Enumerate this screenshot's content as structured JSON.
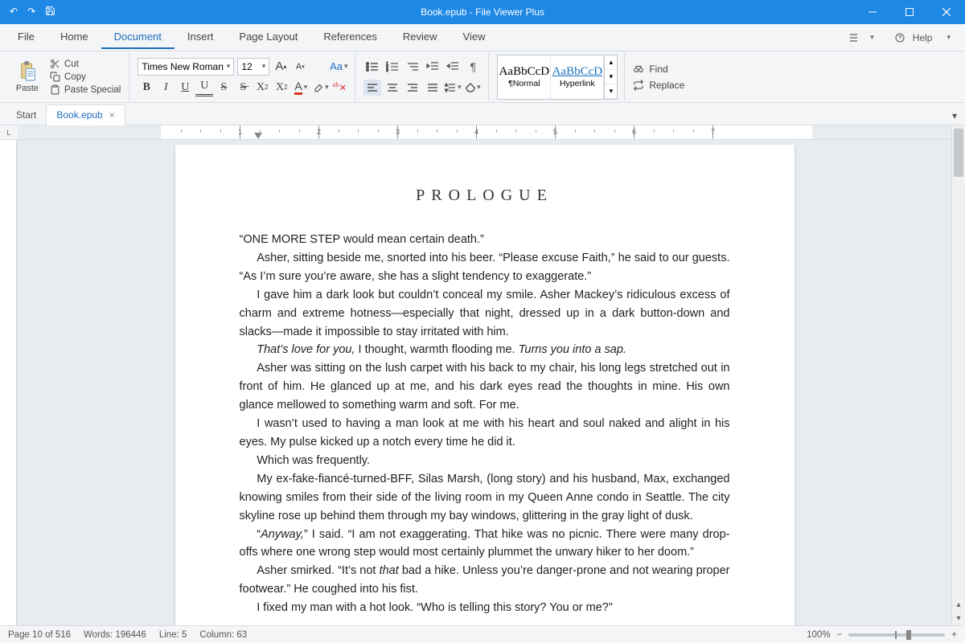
{
  "title": "Book.epub - File Viewer Plus",
  "menu": {
    "items": [
      "File",
      "Home",
      "Document",
      "Insert",
      "Page Layout",
      "References",
      "Review",
      "View"
    ],
    "activeIndex": 2,
    "help": "Help"
  },
  "clipboard": {
    "paste": "Paste",
    "cut": "Cut",
    "copy": "Copy",
    "pasteSpecial": "Paste Special"
  },
  "font": {
    "name": "Times New Roman",
    "size": "12",
    "aa": "Aa"
  },
  "styles": {
    "preview": "AaBbCcD",
    "normal": "¶Normal",
    "hyperlink": "Hyperlink"
  },
  "editing": {
    "find": "Find",
    "replace": "Replace"
  },
  "tabs": {
    "start": "Start",
    "doc": "Book.epub"
  },
  "ruler": {
    "corner": "L"
  },
  "document": {
    "heading": "PROLOGUE",
    "p1": "“ONE MORE STEP would mean certain death.”",
    "p2": "Asher, sitting beside me, snorted into his beer. “Please excuse Faith,” he said to our guests. “As I’m sure you’re aware, she has a slight tendency to exaggerate.”",
    "p3": "I gave him a dark look but couldn’t conceal my smile. Asher Mackey’s ridiculous excess of charm and extreme hotness—especially that night, dressed up in a dark button-down and slacks—made it impossible to stay irritated with him.",
    "p4a": "That’s love for you,",
    "p4b": " I thought, warmth flooding me. ",
    "p4c": "Turns you into a sap.",
    "p5": "Asher was sitting on the lush carpet with his back to my chair, his long legs stretched out in front of him. He glanced up at me, and his dark eyes read the thoughts in mine. His own glance mellowed to something warm and soft. For me.",
    "p6": "I wasn’t used to having a man look at me with his heart and soul naked and alight in his eyes. My pulse kicked up a notch every time he did it.",
    "p7": "Which was frequently.",
    "p8": "My ex-fake-fiancé-turned-BFF, Silas Marsh, (long story) and his husband, Max, exchanged knowing smiles from their side of the living room in my Queen Anne condo in Seattle. The city skyline rose up behind them through my bay windows, glittering in the gray light of dusk.",
    "p9a": "“",
    "p9b": "Anyway,",
    "p9c": "” I said. “I am not exaggerating. That hike was no picnic. There were many drop-offs where one wrong step would most certainly plummet the unwary hiker to her doom.”",
    "p10a": "Asher smirked. “It’s not ",
    "p10b": "that",
    "p10c": " bad a hike. Unless you’re danger-prone and not wearing proper footwear.” He coughed into his fist.",
    "p11": "I fixed my man with a hot look. “Who is telling this story? You or me?”"
  },
  "status": {
    "page": "Page 10 of 516",
    "words": "Words: 196446",
    "line": "Line: 5",
    "column": "Column: 63",
    "zoom": "100%"
  }
}
